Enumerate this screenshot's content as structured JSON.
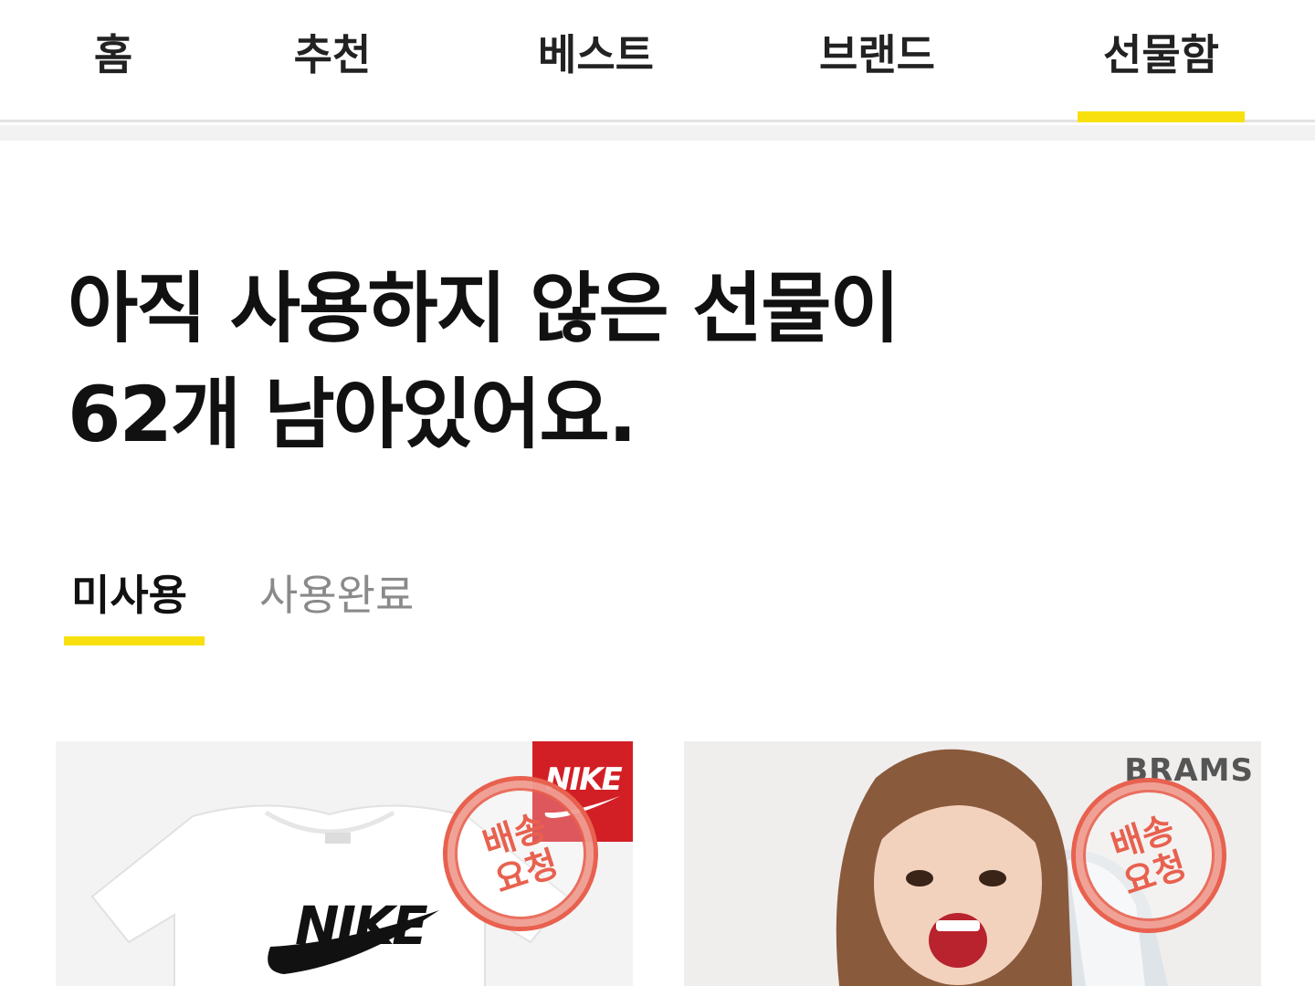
{
  "nav": {
    "tabs": [
      {
        "label": "홈",
        "active": false
      },
      {
        "label": "추천",
        "active": false
      },
      {
        "label": "베스트",
        "active": false
      },
      {
        "label": "브랜드",
        "active": false
      },
      {
        "label": "선물함",
        "active": true
      }
    ]
  },
  "headline": {
    "line1": "아직 사용하지 않은 선물이",
    "line2": "62개 남아있어요."
  },
  "subtabs": [
    {
      "label": "미사용",
      "active": true
    },
    {
      "label": "사용완료",
      "active": false
    }
  ],
  "cards": [
    {
      "brand_logo": "NIKE",
      "stamp": {
        "line1": "배송",
        "line2": "요청"
      },
      "product_text": "NIKE"
    },
    {
      "brand_logo": "BRAMS",
      "stamp": {
        "line1": "배송",
        "line2": "요청"
      }
    }
  ],
  "colors": {
    "accent": "#f7e00e",
    "stamp": "#e8614f",
    "nike_red": "#d21f26"
  }
}
